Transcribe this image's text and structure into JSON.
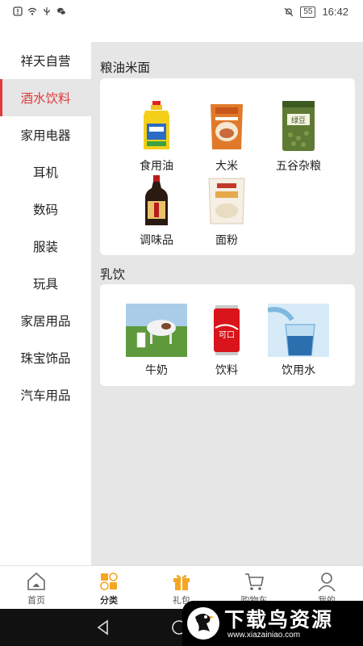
{
  "status_bar": {
    "battery": "55",
    "time": "16:42"
  },
  "sidebar": {
    "items": [
      {
        "label": "祥天自营",
        "active": false
      },
      {
        "label": "酒水饮料",
        "active": true
      },
      {
        "label": "家用电器",
        "active": false
      },
      {
        "label": "耳机",
        "active": false
      },
      {
        "label": "数码",
        "active": false
      },
      {
        "label": "服装",
        "active": false
      },
      {
        "label": "玩具",
        "active": false
      },
      {
        "label": "家居用品",
        "active": false
      },
      {
        "label": "珠宝饰品",
        "active": false
      },
      {
        "label": "汽车用品",
        "active": false
      }
    ]
  },
  "sections": [
    {
      "title": "粮油米面",
      "products": [
        {
          "label": "食用油",
          "icon": "cooking-oil-image"
        },
        {
          "label": "大米",
          "icon": "rice-bag-image"
        },
        {
          "label": "五谷杂粮",
          "icon": "mung-bean-bag-image"
        },
        {
          "label": "调味品",
          "icon": "soy-sauce-bottle-image"
        },
        {
          "label": "面粉",
          "icon": "flour-bag-image"
        }
      ]
    },
    {
      "title": "乳饮",
      "products": [
        {
          "label": "牛奶",
          "icon": "cow-milk-image"
        },
        {
          "label": "饮料",
          "icon": "cola-can-image"
        },
        {
          "label": "饮用水",
          "icon": "water-glass-image"
        }
      ]
    }
  ],
  "bottom_nav": {
    "items": [
      {
        "label": "首页",
        "icon": "home-icon"
      },
      {
        "label": "分类",
        "icon": "category-icon",
        "active": true
      },
      {
        "label": "礼包",
        "icon": "gift-icon"
      },
      {
        "label": "购物车",
        "icon": "cart-icon"
      },
      {
        "label": "我的",
        "icon": "profile-icon"
      }
    ]
  },
  "watermark": {
    "title": "下载鸟资源",
    "url": "www.xiazainiao.com"
  },
  "colors": {
    "accent": "#e03a3a",
    "panel_bg": "#e6e6e6",
    "nav_orange": "#f5a623"
  }
}
